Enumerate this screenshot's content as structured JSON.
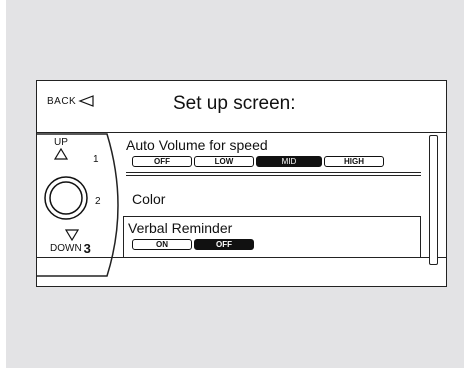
{
  "header": {
    "back_label": "BACK",
    "title": "Set up screen:"
  },
  "knob": {
    "up_label": "UP",
    "down_label": "DOWN",
    "n1": "1",
    "n2": "2",
    "n3": "3"
  },
  "menu": {
    "items": [
      {
        "label": "Auto Volume for speed",
        "options": [
          "OFF",
          "LOW",
          "MID",
          "HIGH"
        ],
        "selected": "MID"
      },
      {
        "label": "Color"
      },
      {
        "label": "Verbal Reminder",
        "options": [
          "ON",
          "OFF"
        ],
        "selected": "OFF"
      }
    ]
  },
  "icons": {
    "back": "triangle-left-icon",
    "up": "triangle-up-icon",
    "down": "triangle-down-icon",
    "knob": "rotary-knob-icon"
  }
}
